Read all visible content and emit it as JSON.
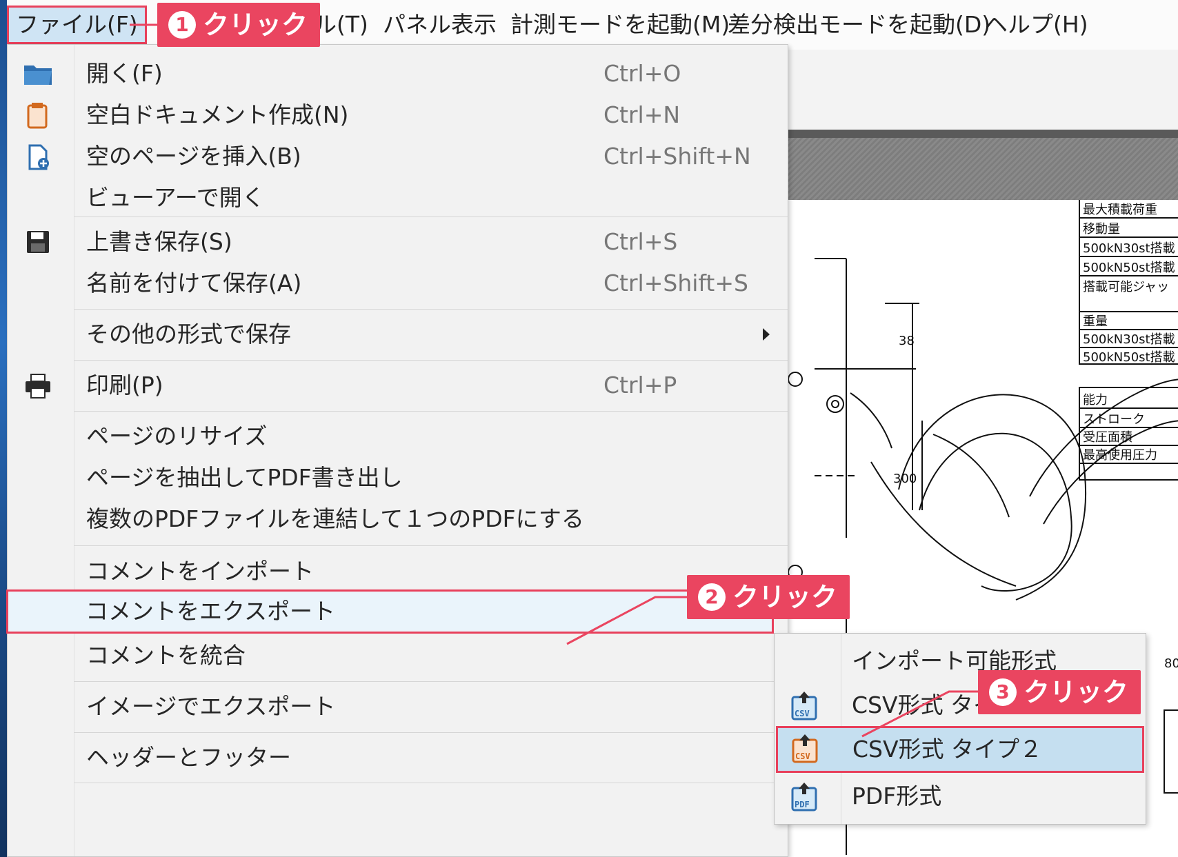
{
  "menubar": {
    "items": [
      {
        "label": "ファイル(F)"
      },
      {
        "label": "ル(T)"
      },
      {
        "label": "パネル表示"
      },
      {
        "label": "計測モードを起動(M)"
      },
      {
        "label": "差分検出モードを起動(D)"
      },
      {
        "label": "ヘルプ(H)"
      }
    ]
  },
  "file_menu": {
    "items": [
      {
        "label": "開く(F)",
        "shortcut": "Ctrl+O",
        "icon": "folder-open-icon"
      },
      {
        "label": "空白ドキュメント作成(N)",
        "shortcut": "Ctrl+N",
        "icon": "blank-document-icon"
      },
      {
        "label": "空のページを挿入(B)",
        "shortcut": "Ctrl+Shift+N",
        "icon": "insert-page-icon"
      },
      {
        "label": "ビューアーで開く",
        "shortcut": ""
      },
      {
        "label": "上書き保存(S)",
        "shortcut": "Ctrl+S",
        "icon": "save-icon"
      },
      {
        "label": "名前を付けて保存(A)",
        "shortcut": "Ctrl+Shift+S"
      },
      {
        "label": "その他の形式で保存",
        "submenu": true
      },
      {
        "label": "印刷(P)",
        "shortcut": "Ctrl+P",
        "icon": "printer-icon"
      },
      {
        "label": "ページのリサイズ"
      },
      {
        "label": "ページを抽出してPDF書き出し"
      },
      {
        "label": "複数のPDFファイルを連結して１つのPDFにする"
      },
      {
        "label": "コメントをインポート"
      },
      {
        "label": "コメントをエクスポート",
        "submenu": true
      },
      {
        "label": "コメントを統合"
      },
      {
        "label": "イメージでエクスポート"
      },
      {
        "label": "ヘッダーとフッター"
      }
    ]
  },
  "export_submenu": {
    "items": [
      {
        "label": "インポート可能形式"
      },
      {
        "label": "CSV形式 タイプ１",
        "icon": "csv-export-icon"
      },
      {
        "label": "CSV形式 タイプ２",
        "icon": "csv-export-icon"
      },
      {
        "label": "PDF形式",
        "icon": "pdf-export-icon"
      }
    ]
  },
  "callouts": [
    {
      "number": "1",
      "text": "クリック"
    },
    {
      "number": "2",
      "text": "クリック"
    },
    {
      "number": "3",
      "text": "クリック"
    }
  ],
  "drawing": {
    "table1": [
      "最大積載荷重",
      "移動量",
      "500kN30st搭載",
      "500kN50st搭載",
      "搭載可能ジャッ",
      "",
      "重量",
      "500kN30st搭載",
      "500kN50st搭載"
    ],
    "table2": [
      "能力",
      "ストローク",
      "受圧面積",
      "最高使用圧力"
    ],
    "dim1": "38",
    "dim2": "300",
    "dim3": "80"
  },
  "colors": {
    "accent": "#ea4560",
    "highlight": "#c5dff0",
    "menu_bg": "#f2f2f2"
  }
}
